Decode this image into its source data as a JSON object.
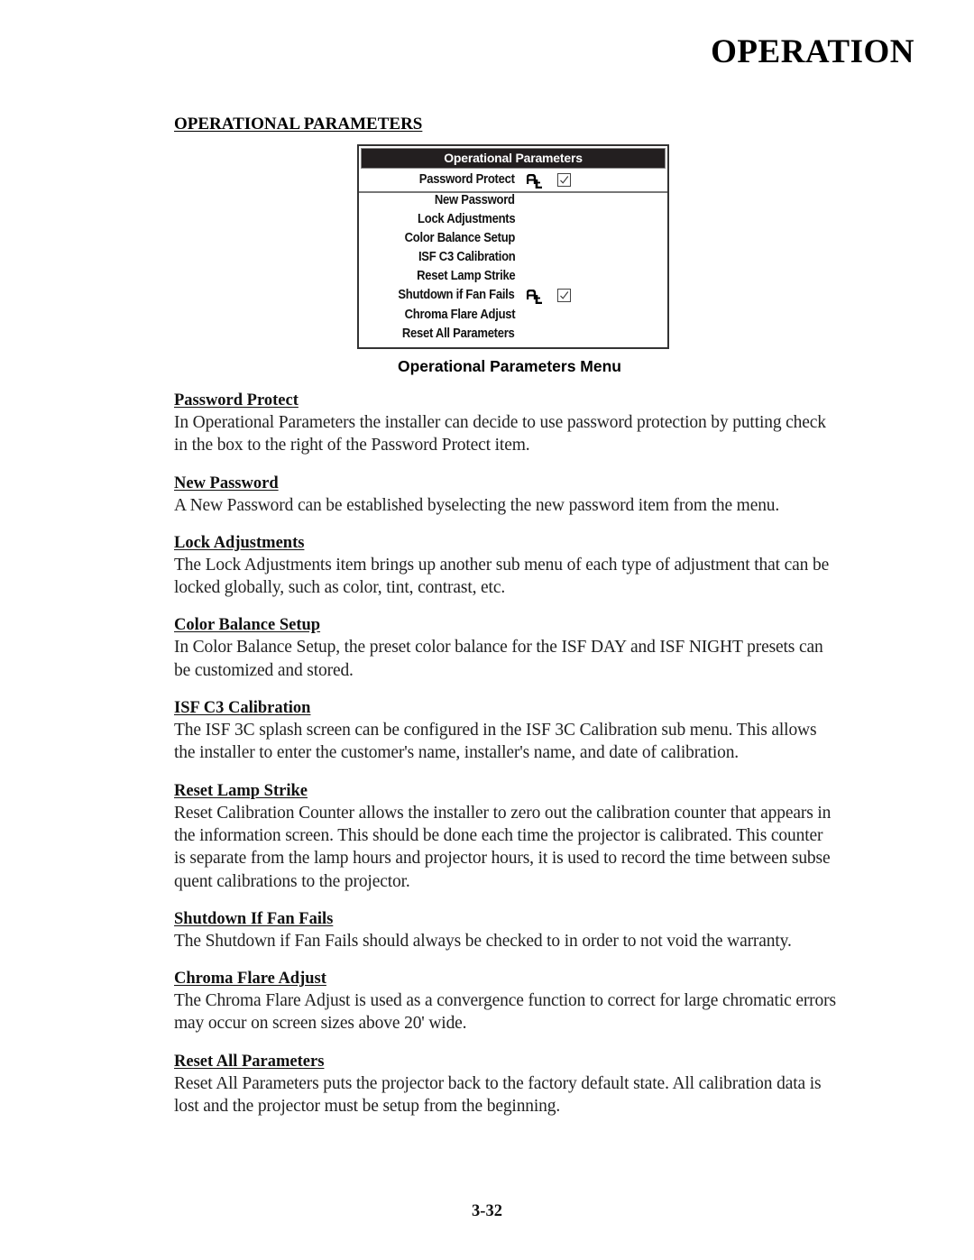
{
  "header": {
    "chapter_title": "OPERATION"
  },
  "section": {
    "title": "OPERATIONAL PARAMETERS"
  },
  "menu": {
    "title": "Operational Parameters",
    "caption": "Operational Parameters Menu",
    "items": [
      {
        "label": "Password Protect",
        "selected": true,
        "locked": true,
        "checked": true
      },
      {
        "label": "New Password",
        "selected": false,
        "locked": false,
        "checked": null
      },
      {
        "label": "Lock Adjustments",
        "selected": false,
        "locked": false,
        "checked": null
      },
      {
        "label": "Color Balance Setup",
        "selected": false,
        "locked": false,
        "checked": null
      },
      {
        "label": "ISF C3 Calibration",
        "selected": false,
        "locked": false,
        "checked": null
      },
      {
        "label": "Reset Lamp Strike",
        "selected": false,
        "locked": false,
        "checked": null
      },
      {
        "label": "Shutdown if Fan Fails",
        "selected": false,
        "locked": true,
        "checked": true
      },
      {
        "label": "Chroma Flare Adjust",
        "selected": false,
        "locked": false,
        "checked": null
      },
      {
        "label": "Reset All Parameters",
        "selected": false,
        "locked": false,
        "checked": null
      }
    ],
    "icons": {
      "lock": "lock-adjust-icon",
      "checkbox": "checkbox-checked-icon"
    }
  },
  "entries": [
    {
      "heading": "Password Protect",
      "lines": [
        "In Operational Parameters the installer can decide to use password protection by putting check",
        "in the box to the right of the Password Protect item."
      ]
    },
    {
      "heading": "New Password",
      "lines": [
        "A New Password can be established byselecting the new password item from the menu."
      ]
    },
    {
      "heading": "Lock Adjustments",
      "lines": [
        "The Lock Adjustments item brings up another sub menu of each type of adjustment that can be",
        "locked globally, such as color, tint, contrast, etc."
      ]
    },
    {
      "heading": "Color Balance Setup",
      "lines": [
        "In Color Balance Setup, the preset color balance for the ISF DAY and ISF NIGHT presets can",
        "be customized and stored."
      ]
    },
    {
      "heading": "ISF C3 Calibration",
      "lines": [
        "The ISF 3C splash screen can be configured in the ISF 3C Calibration sub menu.  This allows",
        "the installer to enter the customer's name, installer's name, and date of calibration."
      ]
    },
    {
      "heading": "Reset Lamp Strike",
      "lines": [
        "Reset Calibration Counter allows the installer to zero out the calibration counter that appears in",
        "the information screen. This should be done each time the projector is calibrated. This counter",
        "is separate from the lamp hours and projector hours, it is used to record the time between subse",
        "quent calibrations to the projector."
      ]
    },
    {
      "heading": "Shutdown If Fan Fails",
      "lines": [
        "The Shutdown if Fan Fails should always be checked to in order to not void the warranty."
      ]
    },
    {
      "heading": "Chroma Flare Adjust",
      "lines": [
        "The Chroma Flare Adjust is used as a convergence function to correct for large chromatic errors",
        "may occur on screen sizes above 20' wide."
      ]
    },
    {
      "heading": "Reset All Parameters",
      "lines": [
        "Reset All Parameters puts the projector back to the factory default state.  All calibration data is",
        "lost and the projector must be setup from the beginning."
      ]
    }
  ],
  "footer": {
    "page_number": "3-32"
  }
}
